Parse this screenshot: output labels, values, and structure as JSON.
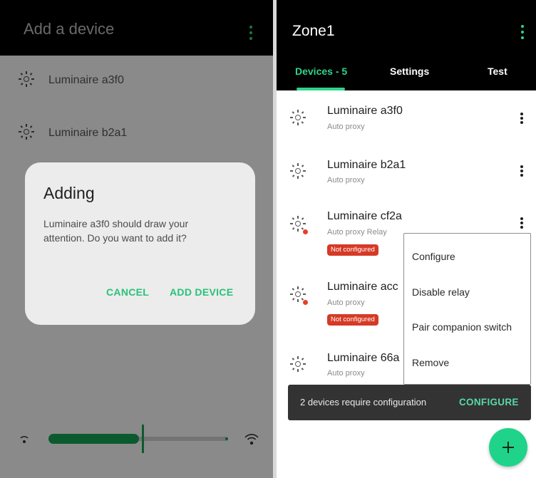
{
  "left": {
    "title": "Add a device",
    "scan_items": [
      {
        "label": "Luminaire a3f0"
      },
      {
        "label": "Luminaire b2a1"
      }
    ],
    "dialog": {
      "title": "Adding",
      "message": "Luminaire a3f0 should draw your attention. Do you want to add it?",
      "cancel_label": "CANCEL",
      "confirm_label": "ADD DEVICE"
    },
    "slider": {
      "value_fraction": 0.52
    }
  },
  "right": {
    "title": "Zone1",
    "tabs": [
      {
        "label": "Devices - 5",
        "active": true
      },
      {
        "label": "Settings",
        "active": false
      },
      {
        "label": "Test",
        "active": false
      }
    ],
    "devices": [
      {
        "name": "Luminaire a3f0",
        "sub": "Auto proxy",
        "badge": ""
      },
      {
        "name": "Luminaire b2a1",
        "sub": "Auto proxy",
        "badge": ""
      },
      {
        "name": "Luminaire cf2a",
        "sub": "Auto proxy  Relay",
        "badge": "Not configured"
      },
      {
        "name": "Luminaire acc",
        "sub": "Auto proxy",
        "badge": "Not configured"
      },
      {
        "name": "Luminaire 66a",
        "sub": "Auto proxy",
        "badge": ""
      }
    ],
    "context_menu": {
      "items": [
        {
          "label": "Configure"
        },
        {
          "label": "Disable relay"
        },
        {
          "label": "Pair companion switch"
        },
        {
          "label": "Remove"
        }
      ]
    },
    "snackbar": {
      "message": "2 devices require configuration",
      "action": "CONFIGURE"
    },
    "fab_label": "+"
  },
  "colors": {
    "accent": "#2ed68a",
    "badge_red": "#d53a26",
    "scrim": "#8a8a8a",
    "appbar": "#000000"
  },
  "icons": {
    "device": "lightbulb-sun-icon",
    "overflow": "more-vert-icon",
    "wifi_low": "wifi-low-icon",
    "wifi_high": "wifi-high-icon",
    "add": "plus-icon"
  }
}
